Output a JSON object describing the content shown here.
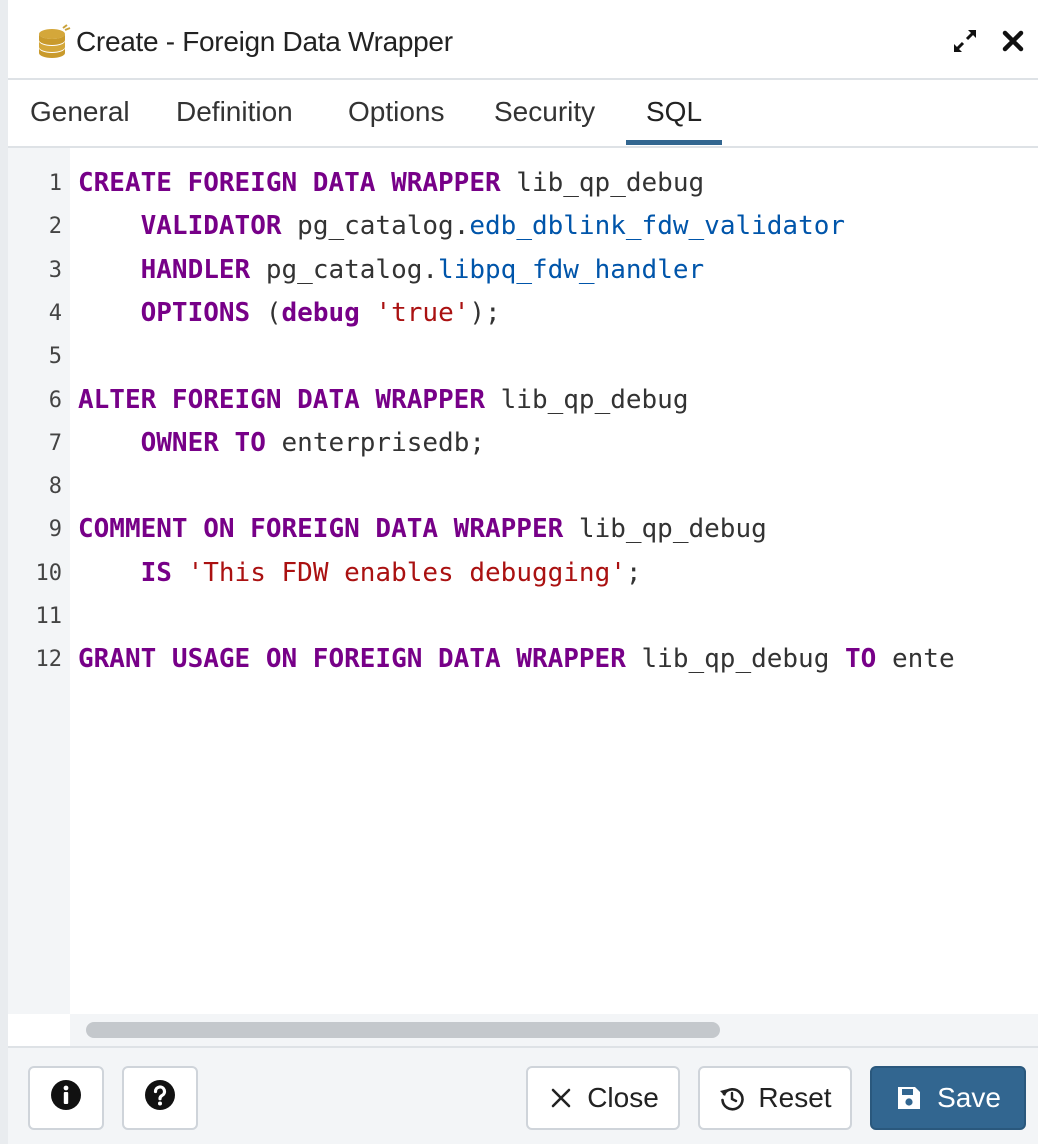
{
  "dialog": {
    "title": "Create - Foreign Data Wrapper",
    "title_icon": "database-stack-icon",
    "expand_icon": "expand-arrows-icon",
    "close_icon": "close-x-icon"
  },
  "tabs": [
    {
      "label": "General",
      "active": false
    },
    {
      "label": "Definition",
      "active": false
    },
    {
      "label": "Options",
      "active": false
    },
    {
      "label": "Security",
      "active": false
    },
    {
      "label": "SQL",
      "active": true
    }
  ],
  "editor": {
    "line_numbers": [
      "1",
      "2",
      "3",
      "4",
      "5",
      "6",
      "7",
      "8",
      "9",
      "10",
      "11",
      "12"
    ],
    "lines": [
      [
        {
          "t": "kw",
          "v": "CREATE FOREIGN DATA WRAPPER"
        },
        {
          "t": "pu",
          "v": " lib_qp_debug"
        }
      ],
      [
        {
          "t": "pu",
          "v": "    "
        },
        {
          "t": "kw",
          "v": "VALIDATOR"
        },
        {
          "t": "pu",
          "v": " pg_catalog."
        },
        {
          "t": "ty",
          "v": "edb_dblink_fdw_validator"
        }
      ],
      [
        {
          "t": "pu",
          "v": "    "
        },
        {
          "t": "kw",
          "v": "HANDLER"
        },
        {
          "t": "pu",
          "v": " pg_catalog."
        },
        {
          "t": "ty",
          "v": "libpq_fdw_handler"
        }
      ],
      [
        {
          "t": "pu",
          "v": "    "
        },
        {
          "t": "kw",
          "v": "OPTIONS"
        },
        {
          "t": "pu",
          "v": " ("
        },
        {
          "t": "kw",
          "v": "debug"
        },
        {
          "t": "pu",
          "v": " "
        },
        {
          "t": "st",
          "v": "'true'"
        },
        {
          "t": "pu",
          "v": ");"
        }
      ],
      [],
      [
        {
          "t": "kw",
          "v": "ALTER FOREIGN DATA WRAPPER"
        },
        {
          "t": "pu",
          "v": " lib_qp_debug"
        }
      ],
      [
        {
          "t": "pu",
          "v": "    "
        },
        {
          "t": "kw",
          "v": "OWNER TO"
        },
        {
          "t": "pu",
          "v": " enterprisedb;"
        }
      ],
      [],
      [
        {
          "t": "kw",
          "v": "COMMENT ON FOREIGN DATA WRAPPER"
        },
        {
          "t": "pu",
          "v": " lib_qp_debug"
        }
      ],
      [
        {
          "t": "pu",
          "v": "    "
        },
        {
          "t": "kw",
          "v": "IS"
        },
        {
          "t": "pu",
          "v": " "
        },
        {
          "t": "st",
          "v": "'This FDW enables debugging'"
        },
        {
          "t": "pu",
          "v": ";"
        }
      ],
      [],
      [
        {
          "t": "kw",
          "v": "GRANT USAGE ON FOREIGN DATA WRAPPER"
        },
        {
          "t": "pu",
          "v": " lib_qp_debug "
        },
        {
          "t": "kw",
          "v": "TO"
        },
        {
          "t": "pu",
          "v": " ente"
        }
      ]
    ],
    "horizontal_scroll_fraction": 0.66
  },
  "footer": {
    "info_icon": "info-circle-icon",
    "help_icon": "question-circle-icon",
    "close_label": "Close",
    "close_icon": "x-icon",
    "reset_label": "Reset",
    "reset_icon": "reset-rotate-icon",
    "save_label": "Save",
    "save_icon": "floppy-disk-icon"
  },
  "colors": {
    "keyword": "#770088",
    "type": "#0055aa",
    "string": "#aa1111",
    "accent": "#326690",
    "gutter_bg": "#f3f5f7"
  }
}
